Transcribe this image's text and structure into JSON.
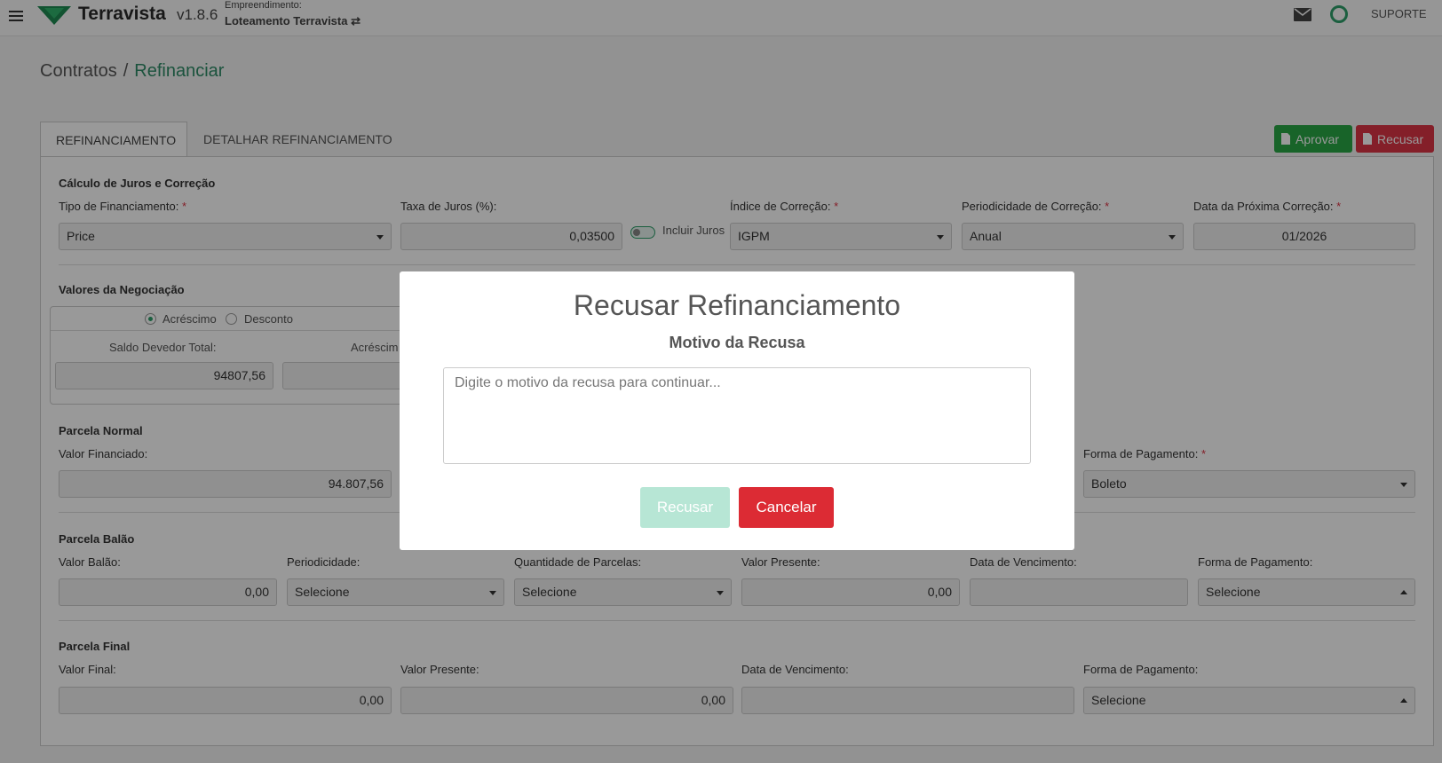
{
  "header": {
    "brand": "Terravista",
    "version": "v1.8.6",
    "empreendimento_label": "Empreendimento:",
    "empreendimento_value": "Loteamento Terravista ⇄",
    "support": "SUPORTE"
  },
  "breadcrumb": {
    "parent": "Contratos",
    "separator": "/",
    "current": "Refinanciar"
  },
  "tabs": [
    "REFINANCIAMENTO",
    "DETALHAR REFINANCIAMENTO"
  ],
  "actions": {
    "approve": "Aprovar",
    "reject": "Recusar"
  },
  "calculo": {
    "title": "Cálculo de Juros e Correção",
    "tipo_label": "Tipo de Financiamento:",
    "tipo_value": "Price",
    "taxa_label": "Taxa de Juros (%):",
    "taxa_value": "0,03500",
    "incluir_juros": "Incluir Juros",
    "indice_label": "Índice de Correção:",
    "indice_value": "IGPM",
    "periodicidade_label": "Periodicidade de Correção:",
    "periodicidade_value": "Anual",
    "data_label": "Data da Próxima Correção:",
    "data_value": "01/2026",
    "required_mark": "*"
  },
  "negociacao": {
    "title": "Valores da Negociação",
    "acrescimo": "Acréscimo",
    "desconto": "Desconto",
    "saldo_label": "Saldo Devedor Total:",
    "saldo_value": "94807,56",
    "acrescimo_label": "Acréscim"
  },
  "parcela_normal": {
    "title": "Parcela Normal",
    "valor_label": "Valor Financiado:",
    "valor_value": "94.807,56",
    "forma_label": "Forma de Pagamento:",
    "forma_value": "Boleto"
  },
  "parcela_balao": {
    "title": "Parcela Balão",
    "valor_label": "Valor Balão:",
    "valor_value": "0,00",
    "periodicidade_label": "Periodicidade:",
    "periodicidade_value": "Selecione",
    "quantidade_label": "Quantidade de Parcelas:",
    "quantidade_value": "Selecione",
    "presente_label": "Valor Presente:",
    "presente_value": "0,00",
    "vencimento_label": "Data de Vencimento:",
    "forma_label": "Forma de Pagamento:",
    "forma_value": "Selecione"
  },
  "parcela_final": {
    "title": "Parcela Final",
    "valor_label": "Valor Final:",
    "valor_value": "0,00",
    "presente_label": "Valor Presente:",
    "presente_value": "0,00",
    "vencimento_label": "Data de Vencimento:",
    "forma_label": "Forma de Pagamento:",
    "forma_value": "Selecione"
  },
  "modal": {
    "title": "Recusar Refinanciamento",
    "subtitle": "Motivo da Recusa",
    "placeholder": "Digite o motivo da recusa para continuar...",
    "confirm": "Recusar",
    "cancel": "Cancelar"
  },
  "colors": {
    "accent": "#2e9e6a",
    "approve": "#28a745",
    "reject": "#dc3545"
  },
  "icons": [
    "menu-icon",
    "terravista-logo",
    "mail-icon",
    "status-ring-icon",
    "document-icon",
    "swap-icon"
  ]
}
